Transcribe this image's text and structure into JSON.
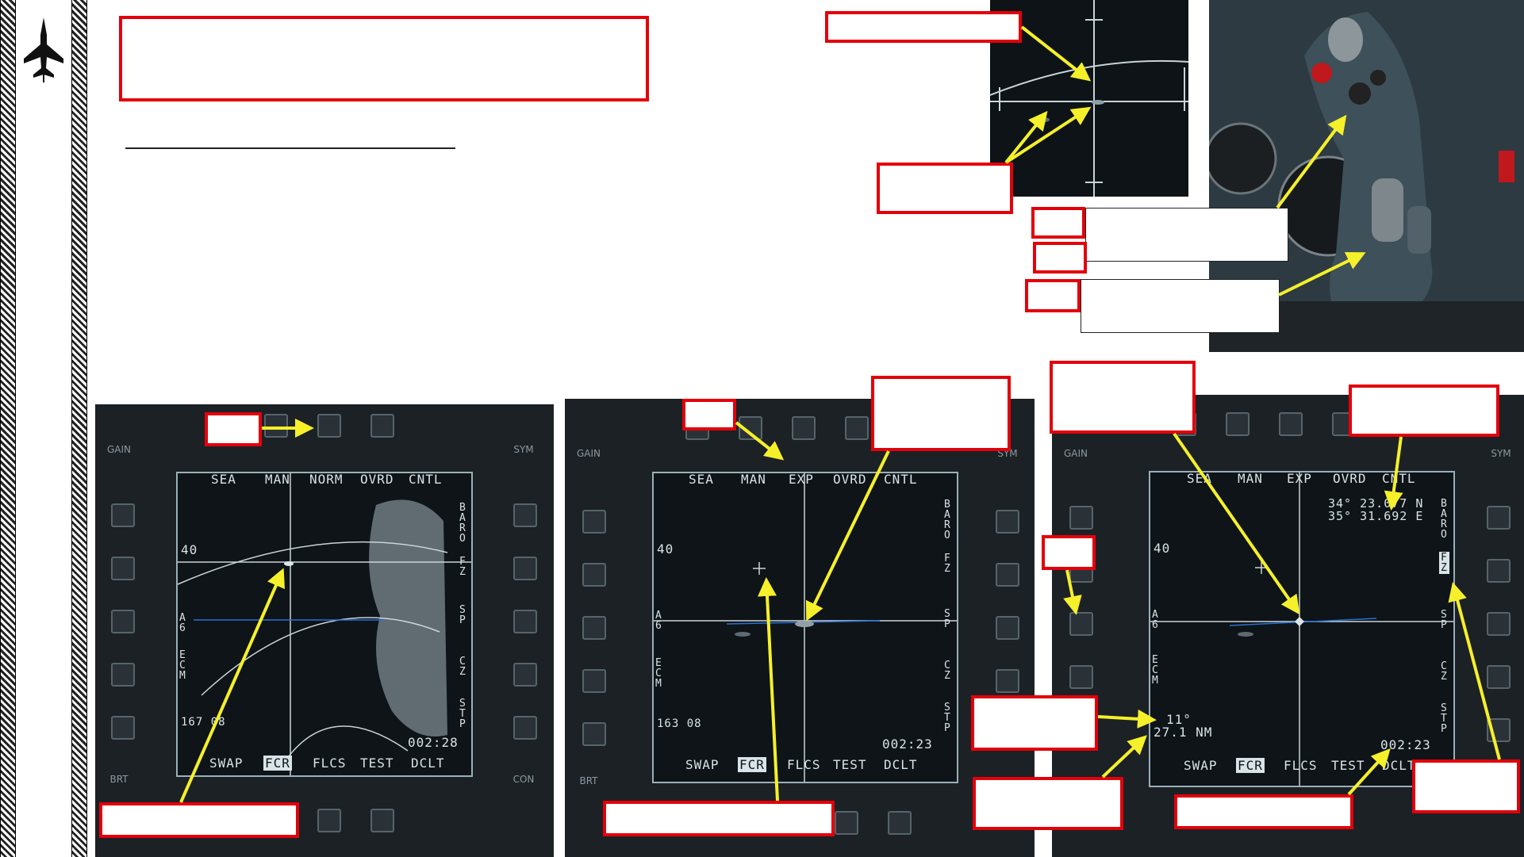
{
  "colors": {
    "callout_border": "#e3000b",
    "arrow": "#f5f02a",
    "mfd_text": "#d8e4e8",
    "mfd_bezel": "#1c2125"
  },
  "icons": {
    "rail": "aircraft-silhouette-icon"
  },
  "mfd_left": {
    "top_labels": [
      "SEA",
      "MAN",
      "NORM",
      "OVRD",
      "CNTL"
    ],
    "bottom_labels": [
      "SWAP",
      "FCR",
      "FLCS",
      "TEST",
      "DCLT"
    ],
    "right_labels": [
      "B",
      "A",
      "R",
      "O",
      "F",
      "Z",
      "S",
      "P",
      "C",
      "Z",
      "S",
      "T",
      "P"
    ],
    "left_vertical": [
      "A",
      "6",
      "E",
      "C",
      "M"
    ],
    "range": "40",
    "heading_speed": "167 08",
    "clock": "002:28",
    "left_rocker": "GAIN",
    "right_rocker": "SYM",
    "lower_left_rocker": "BRT",
    "lower_right_rocker": "CON"
  },
  "mfd_mid": {
    "top_labels": [
      "SEA",
      "MAN",
      "EXP",
      "OVRD",
      "CNTL"
    ],
    "bottom_labels": [
      "SWAP",
      "FCR",
      "FLCS",
      "TEST",
      "DCLT"
    ],
    "right_labels": [
      "B",
      "A",
      "R",
      "O",
      "F",
      "Z",
      "S",
      "P",
      "C",
      "Z",
      "S",
      "T",
      "P"
    ],
    "left_vertical": [
      "A",
      "6",
      "E",
      "C",
      "M"
    ],
    "range": "40",
    "heading_speed": "163 08",
    "clock": "002:23",
    "left_rocker": "GAIN",
    "right_rocker": "SYM",
    "lower_left_rocker": "BRT"
  },
  "mfd_right": {
    "top_labels": [
      "SEA",
      "MAN",
      "EXP",
      "OVRD",
      "CNTL"
    ],
    "bottom_labels": [
      "SWAP",
      "FCR",
      "FLCS",
      "TEST",
      "DCLT"
    ],
    "right_labels": [
      "B",
      "A",
      "R",
      "O",
      "F",
      "Z",
      "S",
      "P",
      "C",
      "Z",
      "S",
      "T",
      "P"
    ],
    "left_vertical": [
      "A",
      "6",
      "E",
      "C",
      "M"
    ],
    "range": "40",
    "coord_lat": "34° 23.077 N",
    "coord_lon": "35° 31.692 E",
    "bearing": "11°",
    "distance": "27.1 NM",
    "clock": "002:23",
    "left_rocker": "GAIN",
    "right_rocker": "SYM"
  }
}
